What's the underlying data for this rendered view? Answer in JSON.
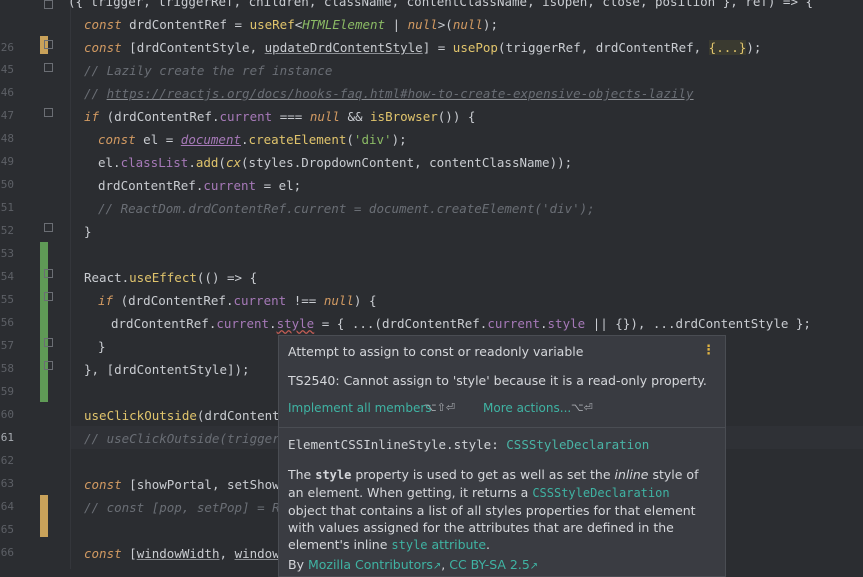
{
  "gutter": {
    "line_numbers": [
      "",
      "26",
      "45",
      "46",
      "47",
      "48",
      "49",
      "50",
      "51",
      "52",
      "53",
      "54",
      "55",
      "56",
      "57",
      "58",
      "59",
      "60",
      "61",
      "62",
      "63",
      "64",
      "65",
      "66"
    ],
    "current_line_index": 18
  },
  "code": {
    "line0_a": "({ trigger, triggerRef, children, className, contentClassName, isOpen, close, position }, ref) => {",
    "l1": {
      "a": "const",
      "b": " drdContentRef = ",
      "c": "useRef",
      "d": "<",
      "e": "HTMLElement",
      "f": " | ",
      "g": "null",
      "h": ">(",
      "i": "null",
      "j": ");"
    },
    "l2": {
      "a": "const",
      "b": " [drdContentStyle, ",
      "c": "updateDrdContentStyle",
      "d": "] = ",
      "e": "usePop",
      "f": "(triggerRef, drdContentRef, ",
      "g": "{...}",
      "h": ");"
    },
    "l3": "// Lazily create the ref instance",
    "l4": {
      "a": "// ",
      "b": "https://reactjs.org/docs/hooks-faq.html#how-to-create-expensive-objects-lazily"
    },
    "l5": {
      "a": "if",
      "b": " (drdContentRef.",
      "c": "current",
      "d": " === ",
      "e": "null",
      "f": " && ",
      "g": "isBrowser",
      "h": "()) {"
    },
    "l6": {
      "a": "const",
      "b": " el = ",
      "c": "document",
      "d": ".",
      "e": "createElement",
      "f": "(",
      "g": "'div'",
      "h": ");"
    },
    "l7": {
      "a": "el.",
      "b": "classList",
      "c": ".",
      "d": "add",
      "e": "(",
      "f": "cx",
      "g": "(styles.DropdownContent, contentClassName));"
    },
    "l8": {
      "a": "drdContentRef.",
      "b": "current",
      "c": " = el;"
    },
    "l9": "// ReactDom.drdContentRef.current = document.createElement('div');",
    "l10": "}",
    "l11": {
      "a": "React.",
      "b": "useEffect",
      "c": "(() => {"
    },
    "l12": {
      "a": "if",
      "b": " (drdContentRef.",
      "c": "current",
      "d": " !== ",
      "e": "null",
      "f": ") {"
    },
    "l13": {
      "a": "drdContentRef.",
      "b": "current",
      "c": ".",
      "d": "style",
      "e": " = { ...(drdContentRef.",
      "f": "current",
      "g": ".",
      "h": "style",
      "i": " || {}), ...drdContentStyle };"
    },
    "l14": "}",
    "l15": "}, [drdContentStyle]);",
    "l16": {
      "a": "useClickOutside",
      "b": "(drdContentRe"
    },
    "l17": "// useClickOutside(triggerRe",
    "l18": {
      "a": "const",
      "b": " [showPortal, setShowPo"
    },
    "l19": "// const [pop, setPop] = Rea",
    "l20": {
      "a": "const",
      "b": " [",
      "c": "windowWidth",
      "d": ", ",
      "e": "windowHe"
    }
  },
  "tooltip": {
    "title": "Attempt to assign to const or readonly variable",
    "menu_icon": "⋮",
    "message": "TS2540: Cannot assign to 'style' because it is a read-only property.",
    "action1": "Implement all members",
    "action1_shortcut": "⌥⇧⏎",
    "action2": "More actions...",
    "action2_shortcut": "⌥⏎",
    "sig_name": "ElementCSSInlineStyle.style",
    "sig_sep": ": ",
    "sig_type": "CSSStyleDeclaration",
    "doc": {
      "p1": "The ",
      "p2": "style",
      "p3": " property is used to get as well as set the ",
      "p4": "inline",
      "p5": " style of an element. When getting, it returns a ",
      "p6": "CSSStyleDeclaration",
      "p7": " object that contains a list of all styles properties for that element with values assigned for the attributes that are defined in the element's inline ",
      "p8": "style",
      "p9": " attribute",
      "p10": "."
    },
    "source_by": "By ",
    "source_author": "Mozilla Contributors",
    "source_sep": ", ",
    "source_license": "CC BY-SA 2.5",
    "ext_icon": "↗"
  },
  "colors": {
    "editor_bg": "#2b2d31",
    "keyword": "#d29a62",
    "function": "#e0c46c",
    "string": "#8bbb65",
    "comment": "#6a6e75",
    "link": "#3fb3a3",
    "modified_marker": "#c9a25a",
    "added_marker": "#5f9a56"
  }
}
